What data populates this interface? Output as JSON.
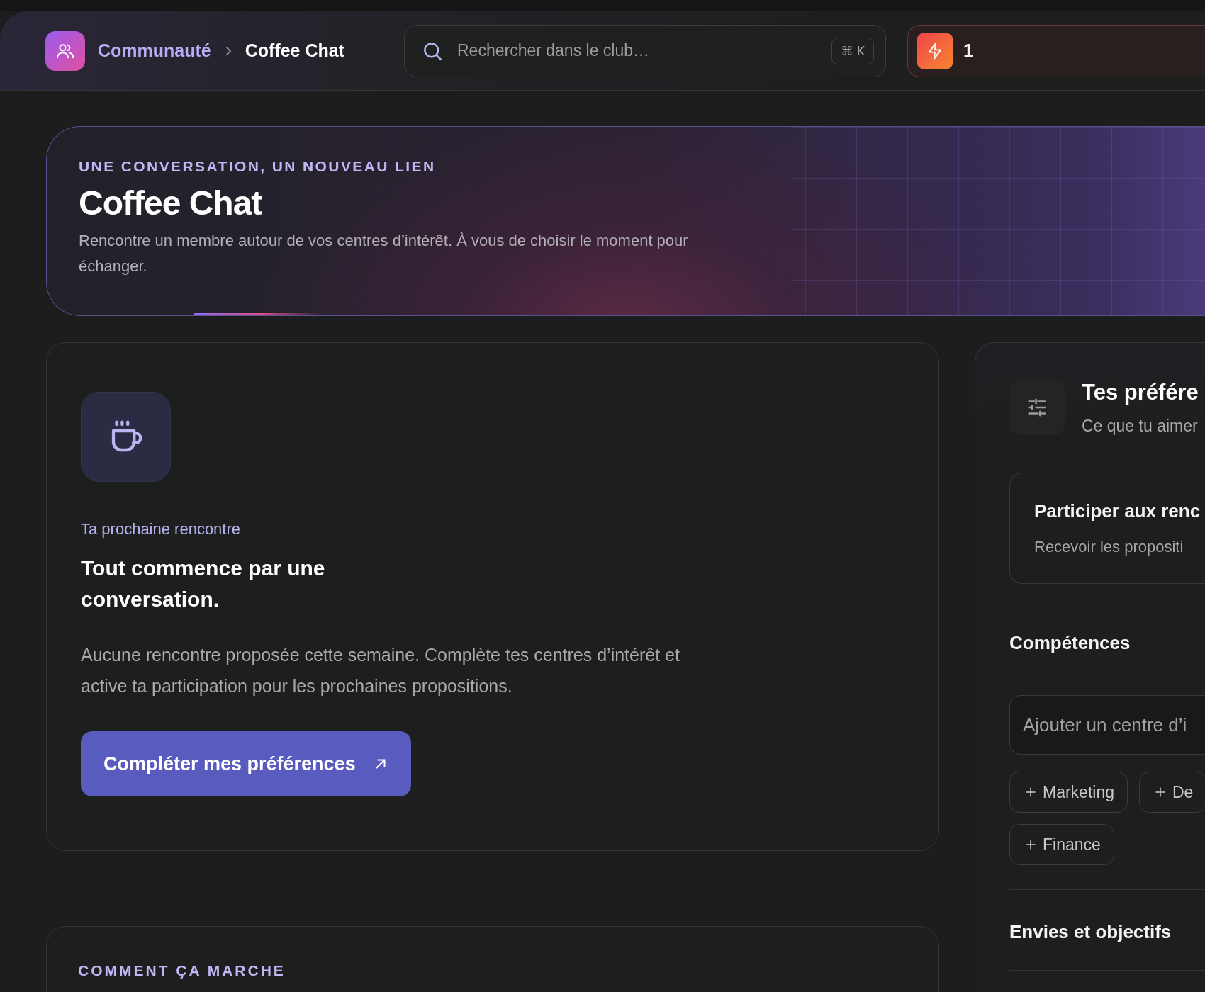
{
  "topbar": {
    "breadcrumb": [
      {
        "label": "Communauté",
        "current": false
      },
      {
        "label": "Coffee Chat",
        "current": true
      }
    ],
    "search": {
      "placeholder": "Rechercher dans le club…",
      "shortcut": "⌘ K"
    },
    "streak": {
      "count": "1"
    }
  },
  "hero": {
    "eyebrow": "UNE CONVERSATION, UN NOUVEAU LIEN",
    "title": "Coffee Chat",
    "description": "Rencontre un membre autour de vos centres d’intérêt. À vous de choisir le moment pour échanger."
  },
  "match_card": {
    "label": "Ta prochaine rencontre",
    "heading": "Tout commence par une conversation.",
    "message": "Aucune rencontre proposée cette semaine. Complète tes centres d’intérêt et active ta participation pour les prochaines propositions.",
    "button": "Compléter mes préférences"
  },
  "preferences": {
    "title": "Tes préfére",
    "subtitle": "Ce que tu aimer",
    "participation": {
      "title": "Participer aux renc",
      "description": "Recevoir les propositi"
    },
    "sections": [
      {
        "kind": "tags",
        "title": "Compétences",
        "input_placeholder": "Ajouter un centre d’i",
        "suggestions": [
          "Marketing",
          "De",
          "Finance"
        ]
      },
      {
        "kind": "heading",
        "title": "Envies et objectifs"
      }
    ]
  },
  "how_it_works": {
    "title": "COMMENT ÇA MARCHE"
  }
}
